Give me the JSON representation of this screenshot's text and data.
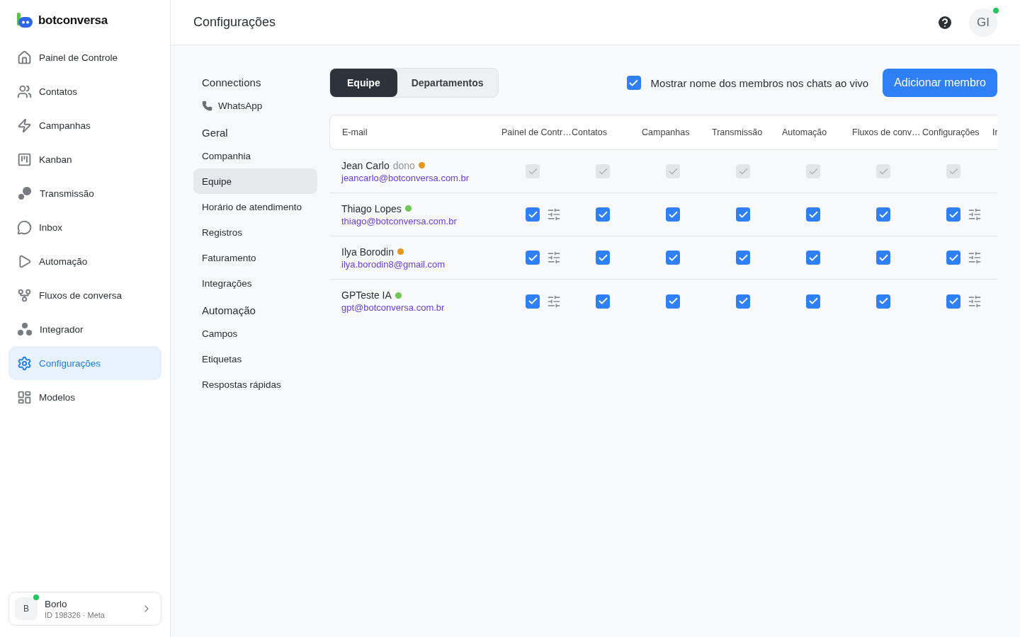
{
  "brand": {
    "name": "botconversa"
  },
  "sidebar": {
    "items": [
      {
        "label": "Painel de Controle",
        "selected": false
      },
      {
        "label": "Contatos",
        "selected": false
      },
      {
        "label": "Campanhas",
        "selected": false
      },
      {
        "label": "Kanban",
        "selected": false
      },
      {
        "label": "Transmissão",
        "selected": false
      },
      {
        "label": "Inbox",
        "selected": false
      },
      {
        "label": "Automação",
        "selected": false
      },
      {
        "label": "Fluxos de conversa",
        "selected": false
      },
      {
        "label": "Integrador",
        "selected": false
      },
      {
        "label": "Configurações",
        "selected": true
      },
      {
        "label": "Modelos",
        "selected": false
      }
    ],
    "account": {
      "initial": "B",
      "name": "Borlo",
      "meta": "ID 198326 · Meta",
      "online": true
    }
  },
  "header": {
    "title": "Configurações",
    "avatar": "GI",
    "online": true
  },
  "settings_nav": [
    {
      "kind": "heading",
      "label": "Connections"
    },
    {
      "kind": "channel",
      "label": "WhatsApp",
      "selected": false
    },
    {
      "kind": "heading",
      "label": "Geral"
    },
    {
      "kind": "item",
      "label": "Companhia",
      "selected": false
    },
    {
      "kind": "item",
      "label": "Equipe",
      "selected": true
    },
    {
      "kind": "item",
      "label": "Horário de atendimento",
      "selected": false
    },
    {
      "kind": "item",
      "label": "Registros",
      "selected": false
    },
    {
      "kind": "item",
      "label": "Faturamento",
      "selected": false
    },
    {
      "kind": "item",
      "label": "Integrações",
      "selected": false
    },
    {
      "kind": "heading",
      "label": "Automação"
    },
    {
      "kind": "item",
      "label": "Campos",
      "selected": false
    },
    {
      "kind": "item",
      "label": "Etiquetas",
      "selected": false
    },
    {
      "kind": "item",
      "label": "Respostas rápidas",
      "selected": false
    }
  ],
  "tabs": [
    {
      "label": "Equipe",
      "selected": true
    },
    {
      "label": "Departamentos",
      "selected": false
    }
  ],
  "show_names": {
    "label": "Mostrar nome dos membros nos chats ao vivo",
    "checked": true
  },
  "add_button": "Adicionar membro",
  "table": {
    "columns": [
      "E-mail",
      "Painel de Contr…",
      "Contatos",
      "Campanhas",
      "Transmissão",
      "Automação",
      "Fluxos de conv…",
      "Configurações",
      "Ir"
    ],
    "rows": [
      {
        "name": "Jean Carlo",
        "role": "dono",
        "email": "jeancarlo@botconversa.com.br",
        "color": "#e8951f",
        "permissions": [
          {
            "checked": true,
            "disabled": true,
            "adjustable": false
          },
          {
            "checked": true,
            "disabled": true,
            "adjustable": false
          },
          {
            "checked": true,
            "disabled": true,
            "adjustable": false
          },
          {
            "checked": true,
            "disabled": true,
            "adjustable": false
          },
          {
            "checked": true,
            "disabled": true,
            "adjustable": false
          },
          {
            "checked": true,
            "disabled": true,
            "adjustable": false
          },
          {
            "checked": true,
            "disabled": true,
            "adjustable": false
          }
        ]
      },
      {
        "name": "Thiago Lopes",
        "email": "thiago@botconversa.com.br",
        "color": "#6cc84f",
        "permissions": [
          {
            "checked": true,
            "disabled": false,
            "adjustable": true
          },
          {
            "checked": true,
            "disabled": false,
            "adjustable": false
          },
          {
            "checked": true,
            "disabled": false,
            "adjustable": false
          },
          {
            "checked": true,
            "disabled": false,
            "adjustable": false
          },
          {
            "checked": true,
            "disabled": false,
            "adjustable": false
          },
          {
            "checked": true,
            "disabled": false,
            "adjustable": false
          },
          {
            "checked": true,
            "disabled": false,
            "adjustable": true
          }
        ]
      },
      {
        "name": "Ilya Borodin",
        "email": "ilya.borodin8@gmail.com",
        "color": "#e8951f",
        "permissions": [
          {
            "checked": true,
            "disabled": false,
            "adjustable": true
          },
          {
            "checked": true,
            "disabled": false,
            "adjustable": false
          },
          {
            "checked": true,
            "disabled": false,
            "adjustable": false
          },
          {
            "checked": true,
            "disabled": false,
            "adjustable": false
          },
          {
            "checked": true,
            "disabled": false,
            "adjustable": false
          },
          {
            "checked": true,
            "disabled": false,
            "adjustable": false
          },
          {
            "checked": true,
            "disabled": false,
            "adjustable": true
          }
        ]
      },
      {
        "name": "GPTeste IA",
        "email": "gpt@botconversa.com.br",
        "color": "#6cc84f",
        "permissions": [
          {
            "checked": true,
            "disabled": false,
            "adjustable": true
          },
          {
            "checked": true,
            "disabled": false,
            "adjustable": false
          },
          {
            "checked": true,
            "disabled": false,
            "adjustable": false
          },
          {
            "checked": true,
            "disabled": false,
            "adjustable": false
          },
          {
            "checked": true,
            "disabled": false,
            "adjustable": false
          },
          {
            "checked": true,
            "disabled": false,
            "adjustable": false
          },
          {
            "checked": true,
            "disabled": false,
            "adjustable": true
          }
        ]
      }
    ]
  }
}
